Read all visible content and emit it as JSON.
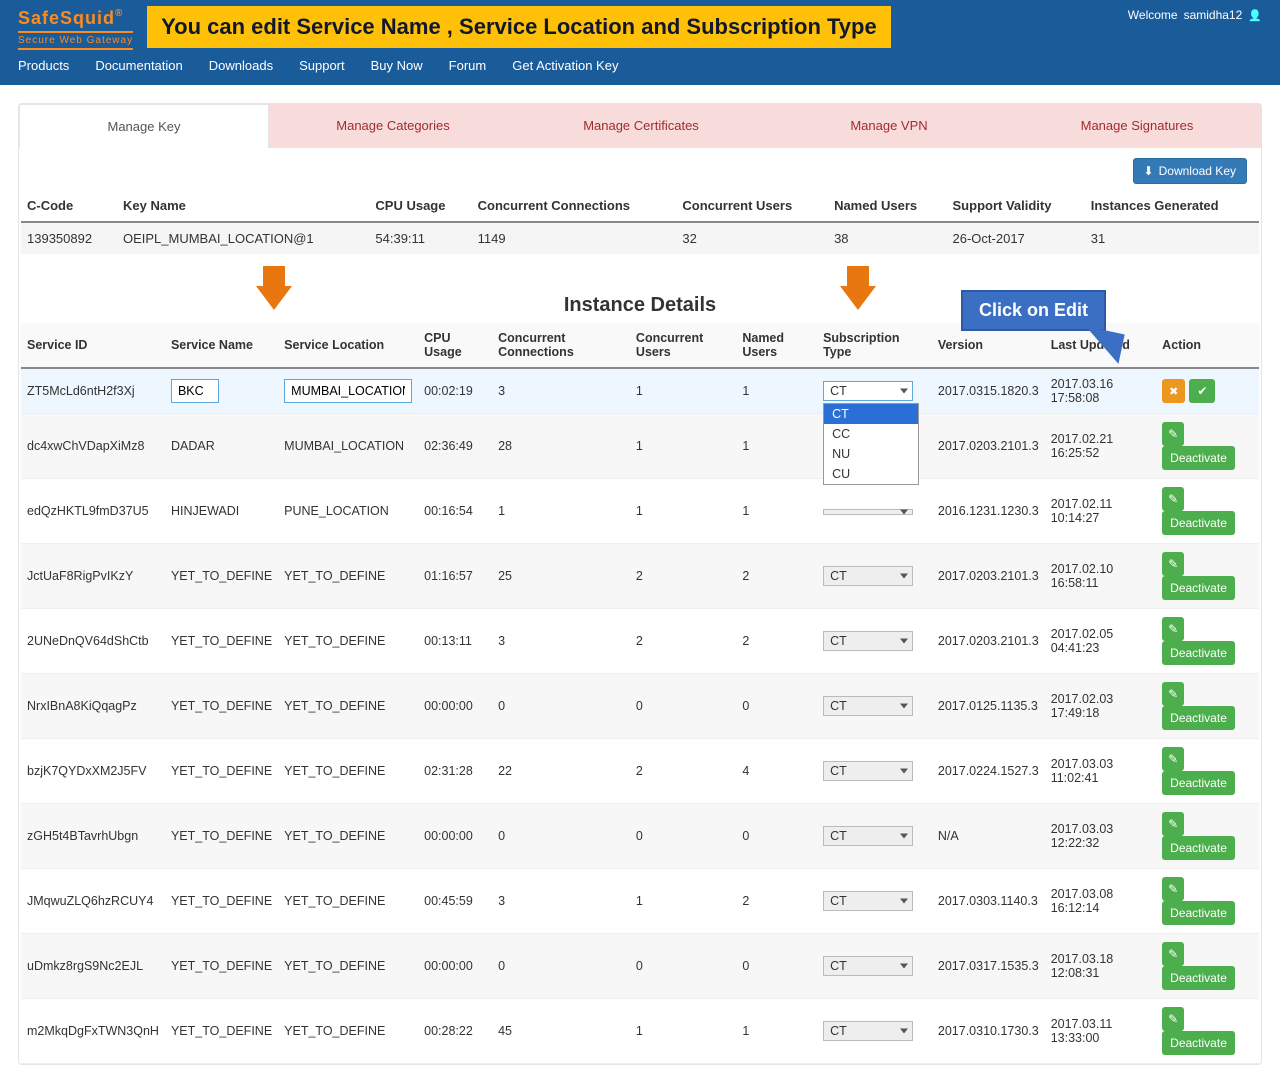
{
  "brand": {
    "name": "SafeSquid",
    "reg": "®",
    "tagline": "Secure Web Gateway"
  },
  "banner": "You can edit Service Name , Service Location and Subscription Type",
  "welcome": {
    "prefix": "Welcome",
    "user": "samidha12"
  },
  "nav": [
    "Products",
    "Documentation",
    "Downloads",
    "Support",
    "Buy Now",
    "Forum",
    "Get Activation Key"
  ],
  "tabs": [
    "Manage Key",
    "Manage Categories",
    "Manage Certificates",
    "Manage VPN",
    "Manage Signatures"
  ],
  "active_tab": 0,
  "download_key_label": "Download Key",
  "key_headers": [
    "C-Code",
    "Key Name",
    "CPU Usage",
    "Concurrent Connections",
    "Concurrent Users",
    "Named Users",
    "Support Validity",
    "Instances Generated"
  ],
  "key_row": {
    "ccode": "139350892",
    "kname": "OEIPL_MUMBAI_LOCATION@1",
    "cpu": "54:39:11",
    "cconn": "1149",
    "cusers": "32",
    "nusers": "38",
    "validity": "26-Oct-2017",
    "inst": "31"
  },
  "section_title": "Instance Details",
  "callout": "Click on Edit",
  "inst_headers": [
    "Service ID",
    "Service Name",
    "Service Location",
    "CPU Usage",
    "Concurrent Connections",
    "Concurrent Users",
    "Named Users",
    "Subscription Type",
    "Version",
    "Last Updated",
    "Action"
  ],
  "sub_options": [
    "CT",
    "CC",
    "NU",
    "CU"
  ],
  "deactivate_label": "Deactivate",
  "rows": [
    {
      "sid": "ZT5McLd6ntH2f3Xj",
      "sname": "BKC",
      "sloc": "MUMBAI_LOCATION",
      "cpu": "00:02:19",
      "cc": "3",
      "cu": "1",
      "nu": "1",
      "sub": "CT",
      "ver": "2017.0315.1820.3",
      "upd": "2017.03.16 17:58:08",
      "editing": true
    },
    {
      "sid": "dc4xwChVDapXiMz8",
      "sname": "DADAR",
      "sloc": "MUMBAI_LOCATION",
      "cpu": "02:36:49",
      "cc": "28",
      "cu": "1",
      "nu": "1",
      "sub": "",
      "ver": "2017.0203.2101.3",
      "upd": "2017.02.21 16:25:52"
    },
    {
      "sid": "edQzHKTL9fmD37U5",
      "sname": "HINJEWADI",
      "sloc": "PUNE_LOCATION",
      "cpu": "00:16:54",
      "cc": "1",
      "cu": "1",
      "nu": "1",
      "sub": "",
      "ver": "2016.1231.1230.3",
      "upd": "2017.02.11 10:14:27"
    },
    {
      "sid": "JctUaF8RigPvIKzY",
      "sname": "YET_TO_DEFINE",
      "sloc": "YET_TO_DEFINE",
      "cpu": "01:16:57",
      "cc": "25",
      "cu": "2",
      "nu": "2",
      "sub": "CT",
      "ver": "2017.0203.2101.3",
      "upd": "2017.02.10 16:58:11"
    },
    {
      "sid": "2UNeDnQV64dShCtb",
      "sname": "YET_TO_DEFINE",
      "sloc": "YET_TO_DEFINE",
      "cpu": "00:13:11",
      "cc": "3",
      "cu": "2",
      "nu": "2",
      "sub": "CT",
      "ver": "2017.0203.2101.3",
      "upd": "2017.02.05 04:41:23"
    },
    {
      "sid": "NrxIBnA8KiQqagPz",
      "sname": "YET_TO_DEFINE",
      "sloc": "YET_TO_DEFINE",
      "cpu": "00:00:00",
      "cc": "0",
      "cu": "0",
      "nu": "0",
      "sub": "CT",
      "ver": "2017.0125.1135.3",
      "upd": "2017.02.03 17:49:18"
    },
    {
      "sid": "bzjK7QYDxXM2J5FV",
      "sname": "YET_TO_DEFINE",
      "sloc": "YET_TO_DEFINE",
      "cpu": "02:31:28",
      "cc": "22",
      "cu": "2",
      "nu": "4",
      "sub": "CT",
      "ver": "2017.0224.1527.3",
      "upd": "2017.03.03 11:02:41"
    },
    {
      "sid": "zGH5t4BTavrhUbgn",
      "sname": "YET_TO_DEFINE",
      "sloc": "YET_TO_DEFINE",
      "cpu": "00:00:00",
      "cc": "0",
      "cu": "0",
      "nu": "0",
      "sub": "CT",
      "ver": "N/A",
      "upd": "2017.03.03 12:22:32"
    },
    {
      "sid": "JMqwuZLQ6hzRCUY4",
      "sname": "YET_TO_DEFINE",
      "sloc": "YET_TO_DEFINE",
      "cpu": "00:45:59",
      "cc": "3",
      "cu": "1",
      "nu": "2",
      "sub": "CT",
      "ver": "2017.0303.1140.3",
      "upd": "2017.03.08 16:12:14"
    },
    {
      "sid": "uDmkz8rgS9Nc2EJL",
      "sname": "YET_TO_DEFINE",
      "sloc": "YET_TO_DEFINE",
      "cpu": "00:00:00",
      "cc": "0",
      "cu": "0",
      "nu": "0",
      "sub": "CT",
      "ver": "2017.0317.1535.3",
      "upd": "2017.03.18 12:08:31"
    },
    {
      "sid": "m2MkqDgFxTWN3QnH",
      "sname": "YET_TO_DEFINE",
      "sloc": "YET_TO_DEFINE",
      "cpu": "00:28:22",
      "cc": "45",
      "cu": "1",
      "nu": "1",
      "sub": "CT",
      "ver": "2017.0310.1730.3",
      "upd": "2017.03.11 13:33:00"
    }
  ]
}
